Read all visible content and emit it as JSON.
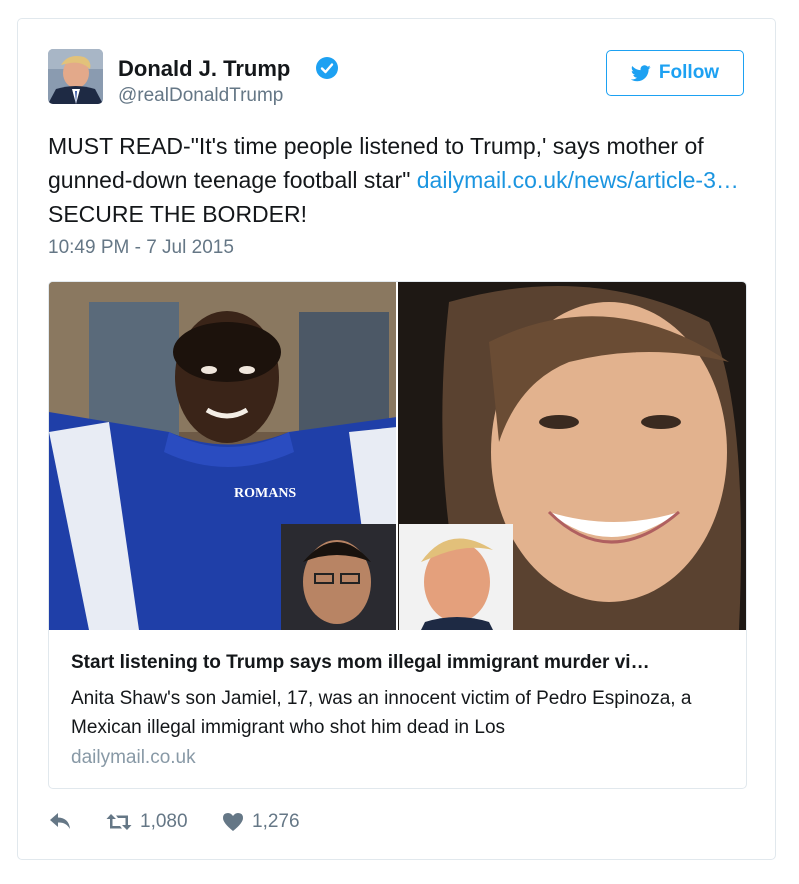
{
  "user": {
    "name": "Donald J. Trump",
    "handle": "@realDonaldTrump"
  },
  "follow_button": {
    "label": "Follow"
  },
  "tweet": {
    "text_before_link": "MUST READ-\"It's time people listened to Trump,' says mother of gunned-down teenage football star\" ",
    "link_text": "dailymail.co.uk/news/article-3…",
    "text_after_link": " SECURE THE BORDER!",
    "timestamp": "10:49 PM - 7 Jul 2015"
  },
  "card": {
    "title": "Start listening to Trump says mom illegal immigrant murder vi…",
    "description": "Anita Shaw's son Jamiel, 17, was an innocent victim of Pedro Espinoza, a Mexican illegal immigrant who shot him dead in Los",
    "domain": "dailymail.co.uk",
    "jersey_text": "ROMANS"
  },
  "actions": {
    "retweets": "1,080",
    "likes": "1,276"
  },
  "colors": {
    "accent": "#1da1f2",
    "link": "#1b95e0",
    "muted": "#657786",
    "border": "#e1e8ed"
  }
}
